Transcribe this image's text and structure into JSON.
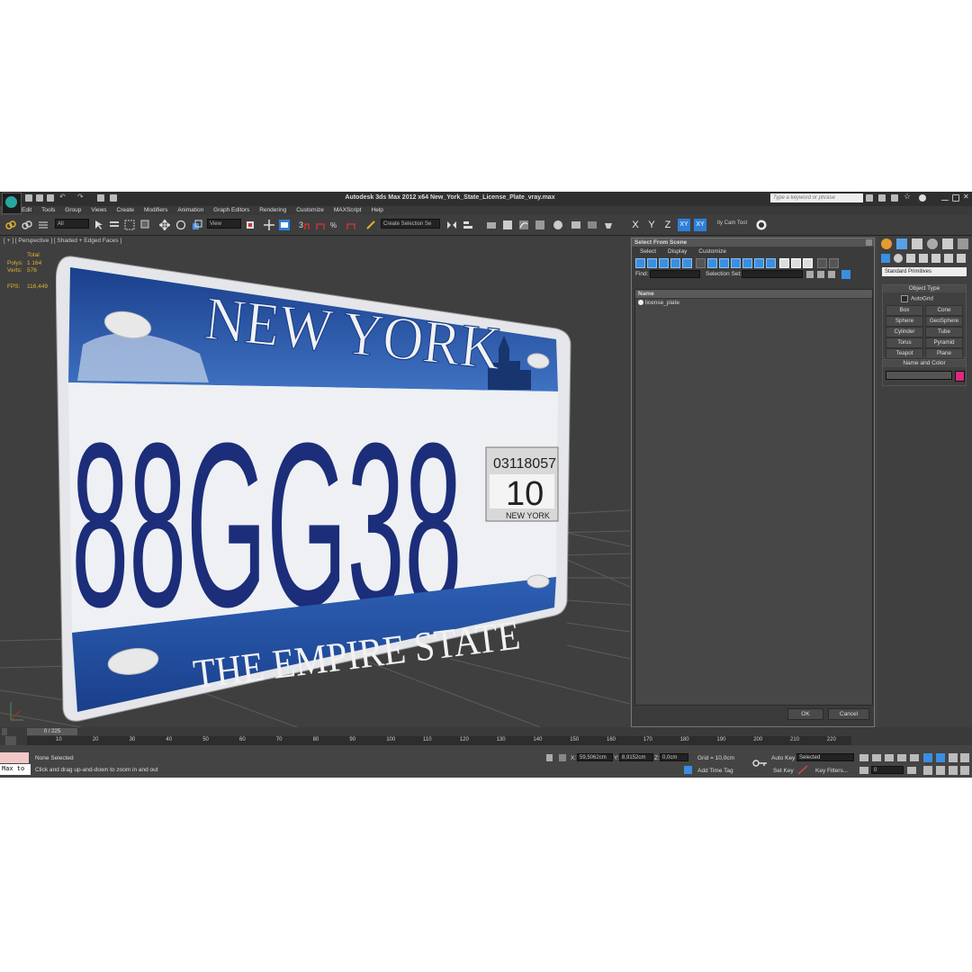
{
  "window": {
    "title": "Autodesk 3ds Max  2012 x64    New_York_State_License_Plate_vray.max",
    "search_placeholder": "Type a keyword or phrase"
  },
  "menu": [
    "Edit",
    "Tools",
    "Group",
    "Views",
    "Create",
    "Modifiers",
    "Animation",
    "Graph Editors",
    "Rendering",
    "Customize",
    "MAXScript",
    "Help"
  ],
  "toolbar": {
    "filter": "All",
    "ref_coord": "View",
    "selection_set": "Create Selection Se",
    "axes": [
      "X",
      "Y",
      "Z",
      "XY",
      "XY"
    ],
    "cam_tool": "ity Cam Tool"
  },
  "viewport": {
    "label": "[ + ] [ Perspective ] [ Shaded + Edged Faces ]",
    "stats": {
      "total_label": "Total",
      "polys_label": "Polys:",
      "polys": "1 164",
      "verts_label": "Verts:",
      "verts": "576",
      "fps_label": "FPS:",
      "fps": "116,449"
    }
  },
  "plate": {
    "state": "NEW YORK",
    "number": "88GG38",
    "slogan": "THE EMPIRE STATE",
    "sticker_id": "03118057",
    "sticker_month": "10",
    "sticker_state": "NEW YORK"
  },
  "dialog": {
    "title": "Select From Scene",
    "menu": [
      "Select",
      "Display",
      "Customize"
    ],
    "find_label": "Find:",
    "selset_label": "Selection Set:",
    "column": "Name",
    "items": [
      "license_plate"
    ],
    "ok": "OK",
    "cancel": "Cancel"
  },
  "command_panel": {
    "category": "Standard Primitives",
    "object_type_title": "Object Type",
    "autogrid": "AutoGrid",
    "primitives": [
      "Box",
      "Cone",
      "Sphere",
      "GeoSphere",
      "Cylinder",
      "Tube",
      "Torus",
      "Pyramid",
      "Teapot",
      "Plane"
    ],
    "name_color_title": "Name and Color",
    "color": "#e0287f"
  },
  "timeline": {
    "frame": "0 / 225",
    "ticks": [
      "10",
      "20",
      "30",
      "40",
      "50",
      "60",
      "70",
      "80",
      "90",
      "100",
      "110",
      "120",
      "130",
      "140",
      "150",
      "160",
      "170",
      "180",
      "190",
      "200",
      "210",
      "220"
    ]
  },
  "status": {
    "selection": "None Selected",
    "prompt": "Click and drag up-and-down to zoom in and out",
    "maxscript": "Max to",
    "x_label": "X:",
    "x": "59,5062cm",
    "y_label": "Y:",
    "y": "8,9152cm",
    "z_label": "Z:",
    "z": "0,0cm",
    "grid": "Grid = 10,0cm",
    "add_time_tag": "Add Time Tag",
    "auto_key": "Auto Key",
    "selected": "Selected",
    "set_key": "Set Key",
    "key_filters": "Key Filters...",
    "frame_field": "0"
  }
}
